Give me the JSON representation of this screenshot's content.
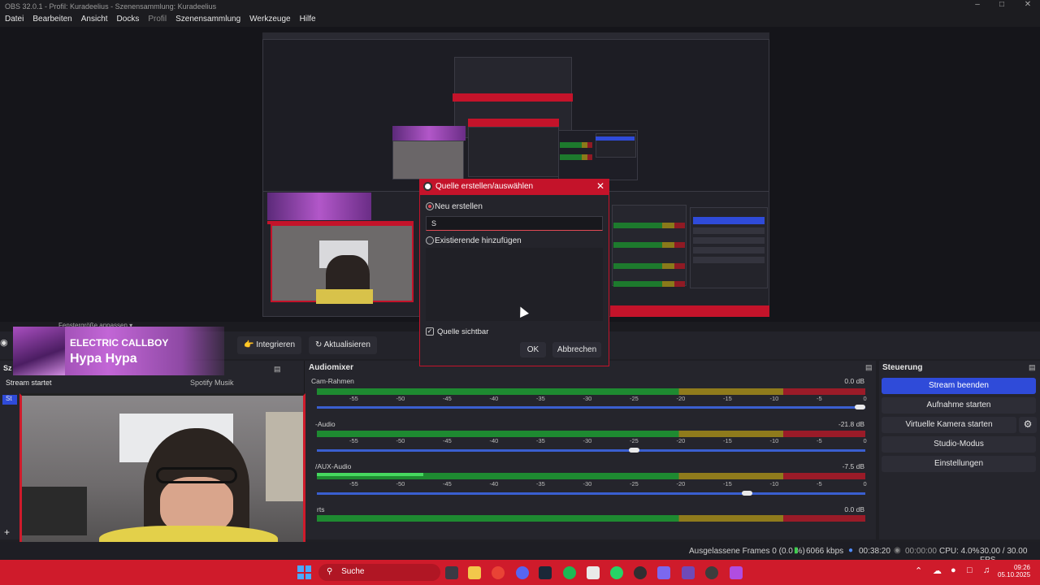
{
  "window": {
    "title": "OBS 32.0.1 - Profil: Kuradeelius - Szenensammlung: Kuradeelius"
  },
  "menu": [
    {
      "label": "Datei"
    },
    {
      "label": "Bearbeiten"
    },
    {
      "label": "Ansicht"
    },
    {
      "label": "Docks"
    },
    {
      "label": "Profil"
    },
    {
      "label": "Szenensammlung"
    },
    {
      "label": "Werkzeuge"
    },
    {
      "label": "Hilfe"
    }
  ],
  "preview": {
    "fit_label": "Fenstergröße anpassen"
  },
  "toolbar": {
    "integrate_label": "Integrieren",
    "refresh_label": "Aktualisieren"
  },
  "overlay": {
    "artist": "ELECTRIC CALLBOY",
    "song": "Hypa Hypa"
  },
  "scenes": {
    "item1": "Stream startet",
    "item2": "Spotify Musik"
  },
  "mixer": {
    "title": "Audiomixer",
    "ticks": [
      "-55",
      "-50",
      "-45",
      "-40",
      "-35",
      "-30",
      "-25",
      "-20",
      "-15",
      "-10",
      "-5",
      "0"
    ],
    "channels": [
      {
        "name": "Cam-Rahmen",
        "db": "0.0 dB",
        "level": 1.0
      },
      {
        "name": "-Audio",
        "db": "-21.8 dB",
        "level": 0.58
      },
      {
        "name": "/AUX-Audio",
        "db": "-7.5 dB",
        "level": 0.79
      },
      {
        "name": "rts",
        "db": "0.0 dB",
        "level": 1.0
      }
    ]
  },
  "controls": {
    "title": "Steuerung",
    "stream": "Stream beenden",
    "record": "Aufnahme starten",
    "virtualcam": "Virtuelle Kamera starten",
    "studio": "Studio-Modus",
    "settings": "Einstellungen"
  },
  "status": {
    "dropped": "Ausgelassene Frames 0 (0.0 %)",
    "bitrate": "6066 kbps",
    "stream_time": "00:38:20",
    "rec_time": "00:00:00",
    "cpu": "CPU: 4.0%",
    "fps": "30.00 / 30.00 FPS"
  },
  "dialog": {
    "title": "Quelle erstellen/auswählen",
    "create_new": "Neu erstellen",
    "name_value": "S",
    "add_existing": "Existierende hinzufügen",
    "visible_label": "Quelle sichtbar",
    "ok": "OK",
    "cancel": "Abbrechen"
  },
  "taskbar": {
    "search_label": "Suche",
    "time": "09:26",
    "date": "05.10.2025"
  },
  "colors": {
    "accent_red": "#cf1b2b",
    "accent_blue": "#2f4bd9",
    "meter_green": "#1e8a31"
  }
}
